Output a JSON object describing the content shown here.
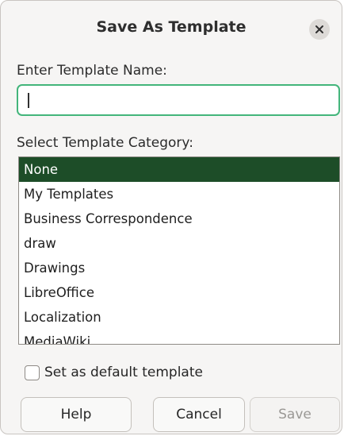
{
  "dialog": {
    "title": "Save As Template",
    "close_icon": "close-icon"
  },
  "name_section": {
    "label": "Enter Template Name:",
    "value": "",
    "focus_color": "#43b57b"
  },
  "category_section": {
    "label": "Select Template Category:",
    "selected_index": 0,
    "selected_color": "#1d4d28",
    "items": [
      {
        "label": "None"
      },
      {
        "label": "My Templates"
      },
      {
        "label": "Business Correspondence"
      },
      {
        "label": "draw"
      },
      {
        "label": "Drawings"
      },
      {
        "label": "LibreOffice"
      },
      {
        "label": "Localization"
      },
      {
        "label": "MediaWiki"
      }
    ]
  },
  "default_checkbox": {
    "label": "Set as default template",
    "checked": false
  },
  "buttons": {
    "help": "Help",
    "cancel": "Cancel",
    "save": "Save"
  }
}
